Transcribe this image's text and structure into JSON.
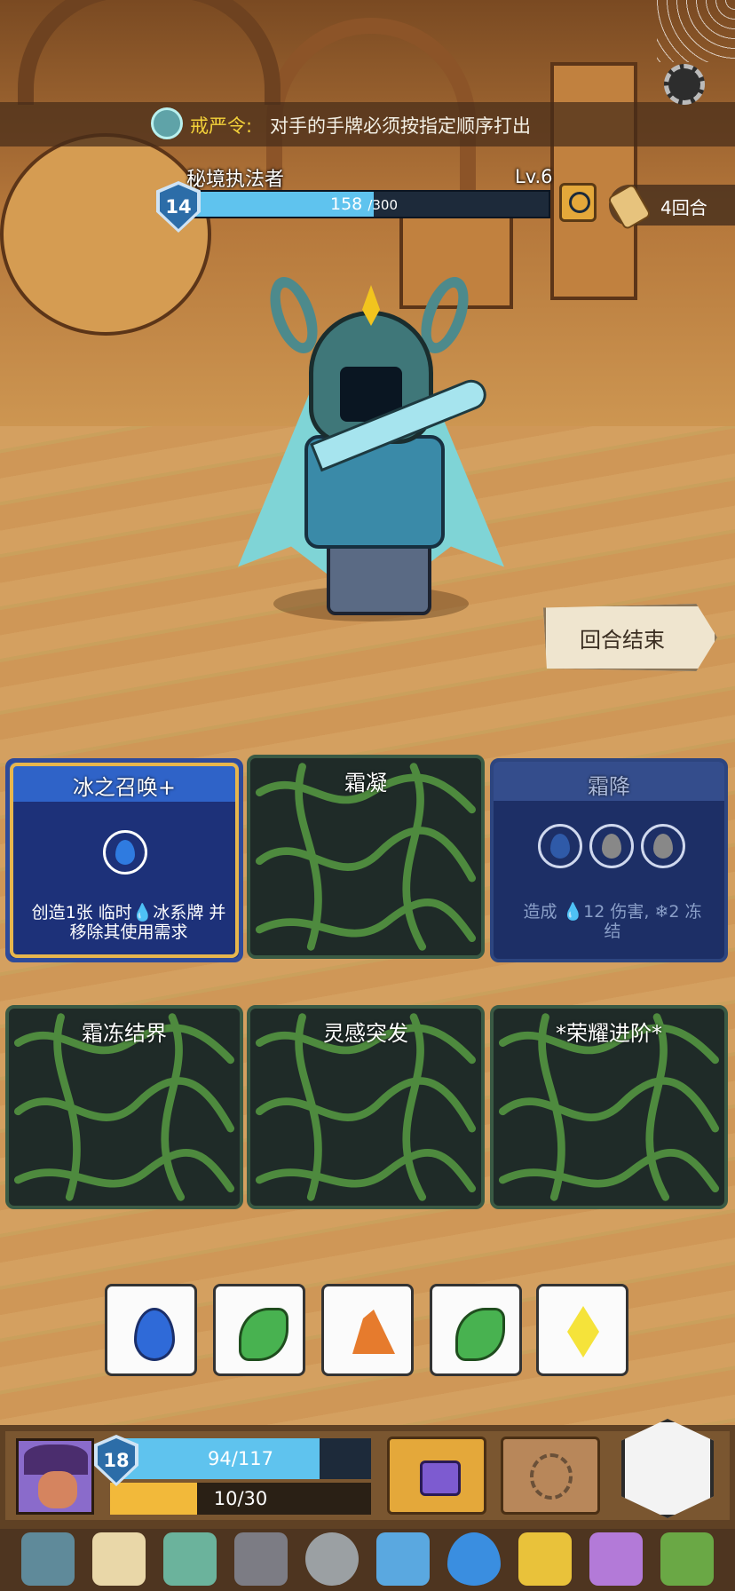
{
  "rule": {
    "title": "戒严令:",
    "text": "对手的手牌必须按指定顺序打出"
  },
  "enemy": {
    "name": "秘境执法者",
    "level": "Lv.6",
    "shield": "14",
    "hp_current": "158",
    "hp_max": "/300",
    "hp_fraction": 0.527
  },
  "rounds": "4回合",
  "end_turn_label": "回合结束",
  "cards_row1": [
    {
      "title": "冰之召唤+",
      "state": "face",
      "desc_line1": "创造1张 临时💧冰系牌 并",
      "desc_line2": "移除其使用需求"
    },
    {
      "title": "霜凝",
      "state": "back"
    },
    {
      "title": "霜降",
      "state": "dim",
      "desc_line1": "造成 💧12 伤害, ❄2 冻",
      "desc_line2": "结"
    }
  ],
  "cards_row2": [
    {
      "title": "霜冻结界",
      "state": "back"
    },
    {
      "title": "灵感突发",
      "state": "back"
    },
    {
      "title": "*荣耀进阶*",
      "state": "back"
    }
  ],
  "dice": [
    "water",
    "leaf",
    "earth",
    "leaf",
    "light"
  ],
  "player": {
    "shield": "18",
    "hp_text": "94/117",
    "hp_fraction": 0.803,
    "xp_text": "10/30",
    "xp_fraction": 0.333
  },
  "relics": [
    "feather-icon",
    "scroll-icon",
    "teapot-icon",
    "gauntlet-icon",
    "coin-icon",
    "potion-icon",
    "water-drop-icon",
    "amulet-icon",
    "boot-icon",
    "cheese-icon"
  ],
  "colors": {
    "hp_bar": "#5fc3ee",
    "xp_bar": "#f2b93a",
    "rule_title": "#f4d23a"
  }
}
